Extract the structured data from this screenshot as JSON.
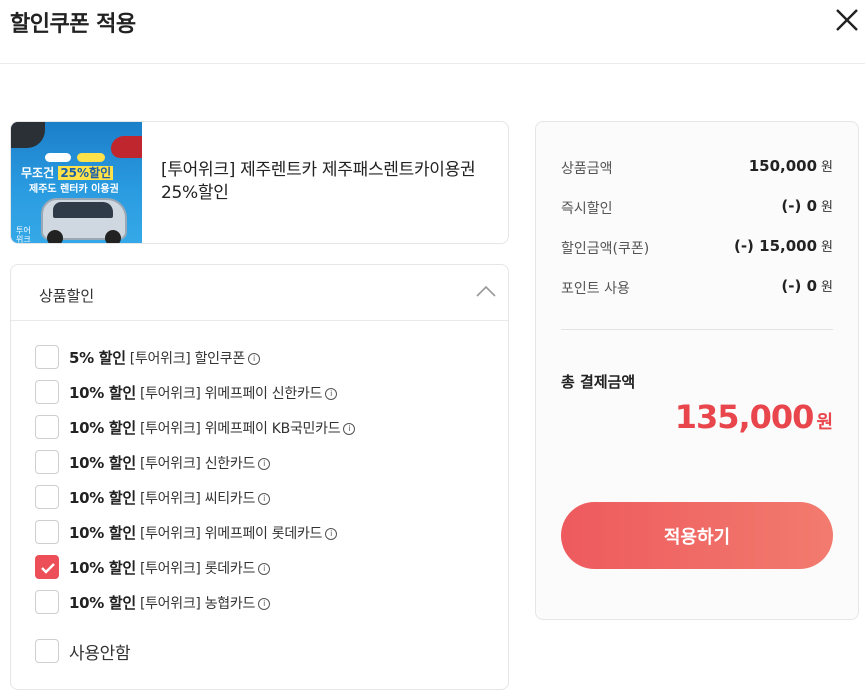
{
  "header": {
    "title": "할인쿠폰 적용"
  },
  "product": {
    "title": "[투어위크] 제주렌트카 제주패스렌트카이용권 25%할인",
    "thumb": {
      "headline_prefix": "무조건",
      "headline_highlight": "25%할인",
      "subline": "제주도 렌터카 이용권",
      "logo": "투어위크"
    }
  },
  "coupons": {
    "section_label": "상품할인",
    "options": [
      {
        "pct": "5% 할인",
        "text": "[투어위크] 할인쿠폰",
        "checked": false
      },
      {
        "pct": "10% 할인",
        "text": "[투어위크] 위메프페이 신한카드",
        "checked": false
      },
      {
        "pct": "10% 할인",
        "text": "[투어위크] 위메프페이 KB국민카드",
        "checked": false
      },
      {
        "pct": "10% 할인",
        "text": "[투어위크] 신한카드",
        "checked": false
      },
      {
        "pct": "10% 할인",
        "text": "[투어위크] 씨티카드",
        "checked": false
      },
      {
        "pct": "10% 할인",
        "text": "[투어위크] 위메프페이 롯데카드",
        "checked": false
      },
      {
        "pct": "10% 할인",
        "text": "[투어위크] 롯데카드",
        "checked": true
      },
      {
        "pct": "10% 할인",
        "text": "[투어위크] 농협카드",
        "checked": false
      }
    ],
    "none_label": "사용안함",
    "info_icon_glyph": "i"
  },
  "summary": {
    "rows": [
      {
        "label": "상품금액",
        "prefix": "",
        "value": "150,000",
        "unit": "원"
      },
      {
        "label": "즉시할인",
        "prefix": "(-)",
        "value": "0",
        "unit": "원"
      },
      {
        "label": "할인금액(쿠폰)",
        "prefix": "(-)",
        "value": "15,000",
        "unit": "원"
      },
      {
        "label": "포인트 사용",
        "prefix": "(-)",
        "value": "0",
        "unit": "원"
      }
    ],
    "total_label": "총 결제금액",
    "total_value": "135,000",
    "total_unit": "원",
    "apply_label": "적용하기"
  },
  "colors": {
    "accent": "#ec4f57",
    "total": "#e9454d"
  }
}
